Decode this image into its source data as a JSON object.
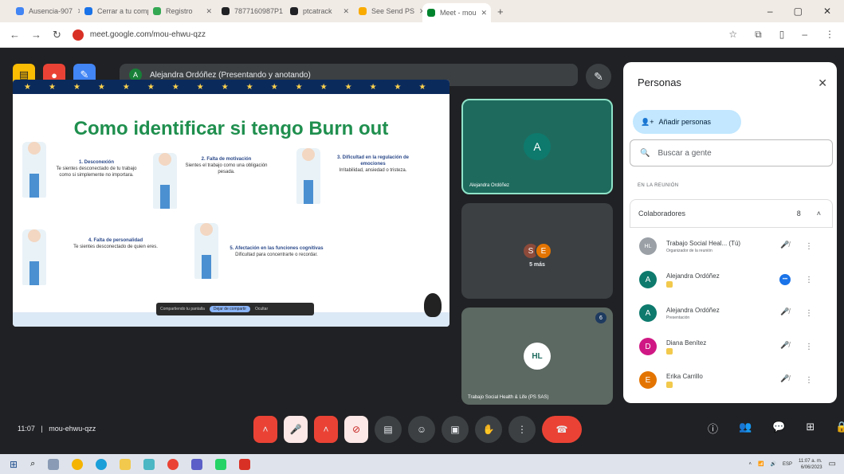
{
  "browser": {
    "tabs": [
      {
        "label": "Ausencia-907",
        "color": "#4285f4"
      },
      {
        "label": "Cerrar a tu comp",
        "color": "#1a73e8"
      },
      {
        "label": "Registro",
        "color": "#34a853"
      },
      {
        "label": "7877160987P1",
        "color": "#202124"
      },
      {
        "label": "ptcatrack",
        "color": "#202124"
      },
      {
        "label": "See Send PS",
        "color": "#f9ab00"
      },
      {
        "label": "Meet - mou",
        "color": "#00832d",
        "active": true
      }
    ],
    "url": "meet.google.com/mou-ehwu-qzz"
  },
  "meeting": {
    "presenter_label": "Alejandra Ordóñez (Presentando y anotando)",
    "presenter_initial": "A",
    "code": "mou-ehwu-qzz",
    "time": "11:07"
  },
  "slide": {
    "title": "Como identificar si tengo Burn out",
    "blocks": [
      {
        "title": "1. Desconexión",
        "text": "Te sientes desconectado de tu trabajo como si simplemente no importara."
      },
      {
        "title": "2. Falta de motivación",
        "text": "Sientes el trabajo como una obligación pesada."
      },
      {
        "title": "3. Dificultad en la regulación de emociones",
        "text": "Irritabilidad, ansiedad o tristeza."
      },
      {
        "title": "4. Falta de personalidad",
        "text": "Te sientes desconectado de quien eres."
      },
      {
        "title": "5. Afectación en las funciones cognitivas",
        "text": "Dificultad para concentrarte o recordar."
      }
    ],
    "share_text": "Compartiendo tu pantalla",
    "stop_label": "Dejar de compartir",
    "hide_label": "Ocultar"
  },
  "tiles": [
    {
      "name": "Alejandra Ordóñez",
      "initial": "A",
      "color": "#0d7a6d"
    },
    {
      "name": "5 más",
      "avatars": [
        {
          "initial": "S",
          "color": "#8d4a3a"
        },
        {
          "initial": "E",
          "color": "#e37400"
        }
      ]
    },
    {
      "name": "Trabajo Social Health & Life (PS SAS)",
      "logo": "HL",
      "badge": "6"
    }
  ],
  "panel": {
    "title": "Personas",
    "add_label": "Añadir personas",
    "search_placeholder": "Buscar a gente",
    "section": "EN LA REUNIÓN",
    "group_label": "Colaboradores",
    "group_count": "8",
    "people": [
      {
        "name": "Trabajo Social Heal... (Tú)",
        "sub": "Organizador de la reunión",
        "initial": "HL",
        "color": "#9aa0a6",
        "mic": "off"
      },
      {
        "name": "Alejandra Ordóñez",
        "sub": "",
        "initial": "A",
        "color": "#0d7a6d",
        "mic": "live"
      },
      {
        "name": "Alejandra Ordóñez",
        "sub": "Presentación",
        "initial": "A",
        "color": "#0d7a6d",
        "mic": "off"
      },
      {
        "name": "Diana Benítez",
        "sub": "",
        "initial": "D",
        "color": "#d01884",
        "mic": "off"
      },
      {
        "name": "Erika Carrillo",
        "sub": "",
        "initial": "E",
        "color": "#e37400",
        "mic": "off"
      }
    ]
  },
  "system": {
    "clock": "11:07 a. m.",
    "date": "6/06/2023",
    "lang": "ESP"
  }
}
